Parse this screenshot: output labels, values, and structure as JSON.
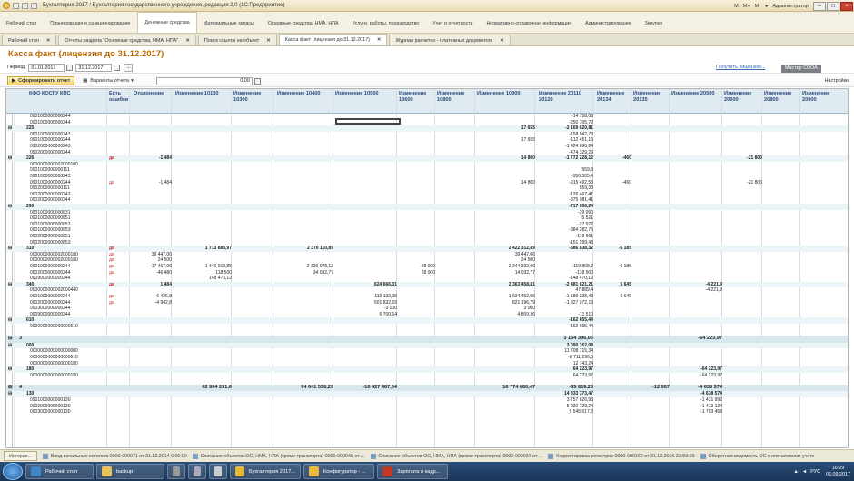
{
  "window": {
    "title": "Бухгалтерия 2017 / Бухгалтерия государственного учреждения, редакция 2.0 (1С:Предприятие)",
    "user": "Администратор",
    "right_icons": [
      "M",
      "M+",
      "M-"
    ]
  },
  "menu": [
    {
      "label": "Рабочий стол"
    },
    {
      "label": "Планирование и санкционирование"
    },
    {
      "label": "Денежные средства",
      "active": true
    },
    {
      "label": "Материальные запасы"
    },
    {
      "label": "Основные средства, НМА, НПА"
    },
    {
      "label": "Услуги, работы, производство"
    },
    {
      "label": "Учет и отчетность"
    },
    {
      "label": "Нормативно-справочная информация"
    },
    {
      "label": "Администрирование"
    },
    {
      "label": "Закупки"
    }
  ],
  "tabs": [
    {
      "label": "Рабочий стол"
    },
    {
      "label": "Отчеты раздела \"Основные средства, НМА, НПА\""
    },
    {
      "label": "Поиск ссылок на объект"
    },
    {
      "label": "Касса факт (лицензия до 31.12.2017)",
      "active": true
    },
    {
      "label": "Журнал расчетно - платежных документов"
    }
  ],
  "page": {
    "title": "Касса факт (лицензия до 31.12.2017)",
    "period_label": "Период:",
    "date_from": "01.01.2017",
    "date_to": "31.12.2017",
    "obtain_license": "Получить лицензию...",
    "master": "Мастер СООА",
    "form_button": "Сформировать отчет",
    "variants_button": "Варианты отчета",
    "sum_value": "0,00",
    "settings": "Настройки"
  },
  "table": {
    "columns": [
      {
        "label": "КФО КОСГУ КПС"
      },
      {
        "label": "Есть ошибки"
      },
      {
        "label": "Отклонение"
      },
      {
        "label": "Изменение 10100"
      },
      {
        "label": "Изменение 10300"
      },
      {
        "label": "Изменение 10400"
      },
      {
        "label": "Изменение 10500"
      },
      {
        "label": "Изменение 10600"
      },
      {
        "label": "Изменение 10800"
      },
      {
        "label": "Изменение 10900"
      },
      {
        "label": "Изменение 20110 20120"
      },
      {
        "label": "Изменение 20134"
      },
      {
        "label": "Изменение 20135"
      },
      {
        "label": "Изменение 20500"
      },
      {
        "label": "Изменение 20600"
      },
      {
        "label": "Изменение 20800"
      },
      {
        "label": "Изменение 20900"
      }
    ],
    "rows": [
      {
        "t": "i",
        "v": [
          "0901000000000244",
          "",
          "",
          "",
          "",
          "",
          "",
          "",
          "",
          "",
          "-14 758,03",
          "",
          "",
          "",
          "",
          "",
          ""
        ]
      },
      {
        "t": "i",
        "v": [
          "0901000000000244",
          "",
          "",
          "",
          "",
          "",
          "",
          "",
          "",
          "",
          "-250 705,72",
          "",
          "",
          "",
          "",
          "",
          ""
        ]
      },
      {
        "t": "g",
        "v": [
          "225",
          "",
          "",
          "",
          "",
          "",
          "",
          "",
          "",
          "17 655",
          "-2 169 620,81",
          "",
          "",
          "",
          "",
          "",
          ""
        ]
      },
      {
        "t": "i",
        "v": [
          "0901000000000243",
          "",
          "",
          "",
          "",
          "",
          "",
          "",
          "",
          "",
          "-158 942,73",
          "",
          "",
          "",
          "",
          "",
          ""
        ]
      },
      {
        "t": "i",
        "v": [
          "0901000000000244",
          "",
          "",
          "",
          "",
          "",
          "",
          "",
          "",
          "17 655",
          "-112 451,15",
          "",
          "",
          "",
          "",
          "",
          ""
        ]
      },
      {
        "t": "i",
        "v": [
          "0902000000000243",
          "",
          "",
          "",
          "",
          "",
          "",
          "",
          "",
          "",
          "-1 424 896,64",
          "",
          "",
          "",
          "",
          "",
          ""
        ]
      },
      {
        "t": "i",
        "v": [
          "0902000000000244",
          "",
          "",
          "",
          "",
          "",
          "",
          "",
          "",
          "",
          "-474 329,29",
          "",
          "",
          "",
          "",
          "",
          ""
        ]
      },
      {
        "t": "g",
        "v": [
          "226",
          "да",
          "-1 484",
          "",
          "",
          "",
          "",
          "",
          "",
          "14 800",
          "-1 772 228,12",
          "-460",
          "",
          "",
          "-21 800",
          "",
          ""
        ]
      },
      {
        "t": "i",
        "v": [
          "0000000000002000100",
          "",
          "",
          "",
          "",
          "",
          "",
          "",
          "",
          "",
          "",
          "",
          "",
          "",
          "",
          "",
          ""
        ]
      },
      {
        "t": "i",
        "v": [
          "0901000000000111",
          "",
          "",
          "",
          "",
          "",
          "",
          "",
          "",
          "",
          "559,3",
          "",
          "",
          "",
          "",
          "",
          ""
        ]
      },
      {
        "t": "i",
        "v": [
          "0901000000000243",
          "",
          "",
          "",
          "",
          "",
          "",
          "",
          "",
          "",
          "-356 305,4",
          "",
          "",
          "",
          "",
          "",
          ""
        ]
      },
      {
        "t": "i",
        "v": [
          "0901000000000244",
          "да",
          "-1 484",
          "",
          "",
          "",
          "",
          "",
          "",
          "14 800",
          "-915 492,53",
          "-460",
          "",
          "",
          "-21 800",
          "",
          ""
        ]
      },
      {
        "t": "i",
        "v": [
          "0902000000000111",
          "",
          "",
          "",
          "",
          "",
          "",
          "",
          "",
          "",
          "559,33",
          "",
          "",
          "",
          "",
          "",
          ""
        ]
      },
      {
        "t": "i",
        "v": [
          "0902000000000243",
          "",
          "",
          "",
          "",
          "",
          "",
          "",
          "",
          "",
          "-126 467,41",
          "",
          "",
          "",
          "",
          "",
          ""
        ]
      },
      {
        "t": "i",
        "v": [
          "0902000000000244",
          "",
          "",
          "",
          "",
          "",
          "",
          "",
          "",
          "",
          "-375 981,41",
          "",
          "",
          "",
          "",
          "",
          ""
        ]
      },
      {
        "t": "g",
        "v": [
          "290",
          "",
          "",
          "",
          "",
          "",
          "",
          "",
          "",
          "",
          "-717 656,24",
          "",
          "",
          "",
          "",
          "",
          ""
        ]
      },
      {
        "t": "i",
        "v": [
          "0901000000000831",
          "",
          "",
          "",
          "",
          "",
          "",
          "",
          "",
          "",
          "-29 090",
          "",
          "",
          "",
          "",
          "",
          ""
        ]
      },
      {
        "t": "i",
        "v": [
          "0901000000000851",
          "",
          "",
          "",
          "",
          "",
          "",
          "",
          "",
          "",
          "-5 521",
          "",
          "",
          "",
          "",
          "",
          ""
        ]
      },
      {
        "t": "i",
        "v": [
          "0901000000000852",
          "",
          "",
          "",
          "",
          "",
          "",
          "",
          "",
          "",
          "-27 972",
          "",
          "",
          "",
          "",
          "",
          ""
        ]
      },
      {
        "t": "i",
        "v": [
          "0901000000000853",
          "",
          "",
          "",
          "",
          "",
          "",
          "",
          "",
          "",
          "-384 282,76",
          "",
          "",
          "",
          "",
          "",
          ""
        ]
      },
      {
        "t": "i",
        "v": [
          "0902000000000851",
          "",
          "",
          "",
          "",
          "",
          "",
          "",
          "",
          "",
          "-119 661",
          "",
          "",
          "",
          "",
          "",
          ""
        ]
      },
      {
        "t": "i",
        "v": [
          "0902000000000853",
          "",
          "",
          "",
          "",
          "",
          "",
          "",
          "",
          "",
          "-151 299,48",
          "",
          "",
          "",
          "",
          "",
          ""
        ]
      },
      {
        "t": "g",
        "v": [
          "310",
          "да",
          "",
          "1 713 883,97",
          "",
          "2 370 110,89",
          "",
          "",
          "",
          "2 422 312,89",
          "-386 838,32",
          "-5 185",
          "",
          "",
          "",
          "",
          ""
        ]
      },
      {
        "t": "i",
        "v": [
          "0000000000002000180",
          "да",
          "39 447,06",
          "",
          "",
          "",
          "",
          "",
          "",
          "39 447,06",
          "",
          "",
          "",
          "",
          "",
          "",
          ""
        ]
      },
      {
        "t": "i",
        "v": [
          "0000000000002000180",
          "да",
          "24 500",
          "",
          "",
          "",
          "",
          "",
          "",
          "24 500",
          "",
          "",
          "",
          "",
          "",
          "",
          ""
        ]
      },
      {
        "t": "i",
        "v": [
          "0901000000000244",
          "да",
          "-17 467,06",
          "1 446 913,85",
          "",
          "2 336 078,12",
          "",
          "-28 000",
          "",
          "2 344 333,06",
          "-119 868,2",
          "-5 185",
          "",
          "",
          "",
          "",
          ""
        ]
      },
      {
        "t": "i",
        "v": [
          "0902000000000244",
          "да",
          "-46 480",
          "118 500",
          "",
          "34 032,77",
          "",
          "28 000",
          "",
          "14 032,77",
          "-118 500",
          "",
          "",
          "",
          "",
          "",
          ""
        ]
      },
      {
        "t": "i",
        "v": [
          "0909000000000244",
          "",
          "",
          "148 470,12",
          "",
          "",
          "",
          "",
          "",
          "",
          "-148 470,12",
          "",
          "",
          "",
          "",
          "",
          ""
        ]
      },
      {
        "t": "g",
        "v": [
          "340",
          "да",
          "1 484",
          "",
          "",
          "",
          "624 666,31",
          "",
          "",
          "2 363 458,81",
          "-2 481 621,21",
          "5 645",
          "",
          "-4 221,9",
          "",
          "",
          ""
        ]
      },
      {
        "t": "i",
        "v": [
          "0000000000002000440",
          "",
          "",
          "",
          "",
          "",
          "",
          "",
          "",
          "",
          "47 889,4",
          "",
          "",
          "-4 221,9",
          "",
          "",
          ""
        ]
      },
      {
        "t": "i",
        "v": [
          "0901000000000244",
          "да",
          "6 426,8",
          "",
          "",
          "",
          "119 133,08",
          "",
          "",
          "1 634 452,66",
          "-1 189 228,43",
          "5 645",
          "",
          "",
          "",
          "",
          ""
        ]
      },
      {
        "t": "i",
        "v": [
          "0902000000000244",
          "да",
          "-4 942,8",
          "",
          "",
          "",
          "501 832,59",
          "",
          "",
          "821 196,79",
          "-1 327 972,19",
          "",
          "",
          "",
          "",
          "",
          ""
        ]
      },
      {
        "t": "i",
        "v": [
          "0903000000000244",
          "",
          "",
          "",
          "",
          "",
          "-3 000",
          "",
          "",
          "3 000",
          "",
          "",
          "",
          "",
          "",
          "",
          ""
        ]
      },
      {
        "t": "i",
        "v": [
          "0909000000000244",
          "",
          "",
          "",
          "",
          "",
          "6 700,64",
          "",
          "",
          "4 809,36",
          "-11 510",
          "",
          "",
          "",
          "",
          "",
          ""
        ]
      },
      {
        "t": "g",
        "v": [
          "610",
          "",
          "",
          "",
          "",
          "",
          "",
          "",
          "",
          "",
          "-162 655,44",
          "",
          "",
          "",
          "",
          "",
          ""
        ]
      },
      {
        "t": "i",
        "v": [
          "0000000000000000610",
          "",
          "",
          "",
          "",
          "",
          "",
          "",
          "",
          "",
          "-162 655,44",
          "",
          "",
          "",
          "",
          "",
          ""
        ]
      },
      {
        "t": "i",
        "v": [
          "",
          "",
          "",
          "",
          "",
          "",
          "",
          "",
          "",
          "",
          "",
          "",
          "",
          "",
          "",
          "",
          ""
        ]
      },
      {
        "t": "top",
        "v": [
          "3",
          "",
          "",
          "",
          "",
          "",
          "",
          "",
          "",
          "",
          "3 154 386,05",
          "",
          "",
          "-64 223,97",
          "",
          "",
          ""
        ]
      },
      {
        "t": "g",
        "v": [
          "000",
          "",
          "",
          "",
          "",
          "",
          "",
          "",
          "",
          "",
          "3 090 162,08",
          "",
          "",
          "",
          "",
          "",
          ""
        ]
      },
      {
        "t": "i",
        "v": [
          "0000000000000000000",
          "",
          "",
          "",
          "",
          "",
          "",
          "",
          "",
          "",
          "11 708 715,34",
          "",
          "",
          "",
          "",
          "",
          ""
        ]
      },
      {
        "t": "i",
        "v": [
          "0000000000000000610",
          "",
          "",
          "",
          "",
          "",
          "",
          "",
          "",
          "",
          "-8 711 296,5",
          "",
          "",
          "",
          "",
          "",
          ""
        ]
      },
      {
        "t": "i",
        "v": [
          "0000000000000000180",
          "",
          "",
          "",
          "",
          "",
          "",
          "",
          "",
          "",
          "12 743,24",
          "",
          "",
          "",
          "",
          "",
          ""
        ]
      },
      {
        "t": "g",
        "v": [
          "180",
          "",
          "",
          "",
          "",
          "",
          "",
          "",
          "",
          "",
          "64 223,97",
          "",
          "",
          "-64 223,97",
          "",
          "",
          ""
        ]
      },
      {
        "t": "i",
        "v": [
          "0000000000000000180",
          "",
          "",
          "",
          "",
          "",
          "",
          "",
          "",
          "",
          "64 223,97",
          "",
          "",
          "-64 223,97",
          "",
          "",
          ""
        ]
      },
      {
        "t": "i",
        "v": [
          "",
          "",
          "",
          "",
          "",
          "",
          "",
          "",
          "",
          "",
          "",
          "",
          "",
          "",
          "",
          "",
          ""
        ]
      },
      {
        "t": "top",
        "v": [
          "4",
          "",
          "",
          "62 894 291,6",
          "",
          "94 041 538,29",
          "-16 427 487,04",
          "",
          "",
          "16 774 680,47",
          "-35 869,26",
          "",
          "-12 957",
          "-4 638 574",
          "",
          "",
          ""
        ]
      },
      {
        "t": "g",
        "v": [
          "130",
          "",
          "",
          "",
          "",
          "",
          "",
          "",
          "",
          "",
          "14 333 373,47",
          "",
          "",
          "-4 638 574",
          "",
          "",
          ""
        ]
      },
      {
        "t": "i",
        "v": [
          "0901000000000130",
          "",
          "",
          "",
          "",
          "",
          "",
          "",
          "",
          "",
          "3 757 626,93",
          "",
          "",
          "-1 431 992",
          "",
          "",
          ""
        ]
      },
      {
        "t": "i",
        "v": [
          "0902000000000130",
          "",
          "",
          "",
          "",
          "",
          "",
          "",
          "",
          "",
          "5 030 729,24",
          "",
          "",
          "-1 413 124",
          "",
          "",
          ""
        ]
      },
      {
        "t": "i",
        "v": [
          "0903000000000130",
          "",
          "",
          "",
          "",
          "",
          "",
          "",
          "",
          "",
          "5 545 017,3",
          "",
          "",
          "-1 793 458",
          "",
          "",
          ""
        ]
      }
    ]
  },
  "status": {
    "history": "История...",
    "items": [
      "Ввод начальных остатков 0000-000071 от 31.12.2014 0:00:00",
      "Списание объектов ОС, НМА, НПА (кроме транспорта) 0000-000049 от ...",
      "Списание объектов ОС, НМА, НПА (кроме транспорта) 0000-000037 от ...",
      "Корректировка регистров 0000-000162 от 31.12.2016 23:59:59",
      "Оборотная ведомость ОС в оперативном учете"
    ]
  },
  "taskbar": {
    "items": [
      {
        "label": "Рабочий стол",
        "color": "#3d86c6"
      },
      {
        "label": "backup",
        "color": "#e8c15a"
      },
      {
        "label": "Бухгалтерия 2017...",
        "color": "#e8b93a"
      },
      {
        "label": "Конфигуратор - ...",
        "color": "#e8b93a"
      },
      {
        "label": "Зарплата и кадр...",
        "color": "#c0392b"
      }
    ],
    "lang": "РУС",
    "time": "16:29",
    "date": "06.09.2017"
  }
}
